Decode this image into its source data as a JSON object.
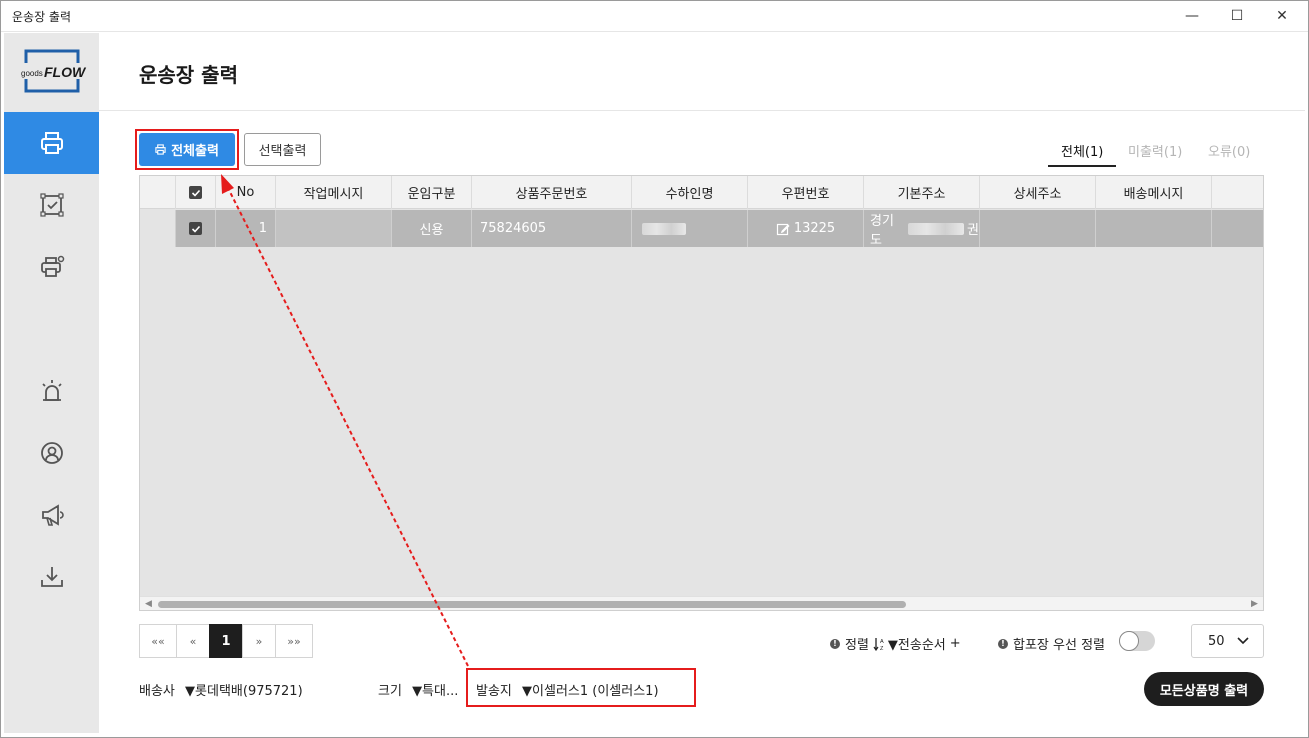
{
  "window": {
    "title": "운송장 출력",
    "minimize_glyph": "—",
    "maximize_glyph": "☐",
    "close_glyph": "✕"
  },
  "logo": {
    "text_small": "goods",
    "text_big": "FLOW"
  },
  "sidebar": {
    "items": [
      {
        "icon": "printer-icon",
        "active": true
      },
      {
        "icon": "checkbox-frame-icon",
        "active": false
      },
      {
        "icon": "printer-settings-icon",
        "active": false
      },
      {
        "icon": "alarm-icon",
        "active": false
      },
      {
        "icon": "user-circle-icon",
        "active": false
      },
      {
        "icon": "megaphone-icon",
        "active": false
      },
      {
        "icon": "download-icon",
        "active": false
      }
    ]
  },
  "page": {
    "title": "운송장 출력"
  },
  "toolbar": {
    "print_all_label": "전체출력",
    "print_selected_label": "선택출력"
  },
  "tabs": [
    {
      "label": "전체(1)",
      "active": true
    },
    {
      "label": "미출력(1)",
      "active": false
    },
    {
      "label": "오류(0)",
      "active": false
    }
  ],
  "table": {
    "columns": [
      "No",
      "작업메시지",
      "운임구분",
      "상품주문번호",
      "수하인명",
      "우편번호",
      "기본주소",
      "상세주소",
      "배송메시지"
    ],
    "rows": [
      {
        "checked": true,
        "no": "1",
        "work_message": "",
        "fare_type": "신용",
        "order_no": "75824605",
        "receiver": "",
        "zip": "13225",
        "address_prefix": "경기도",
        "address_suffix": "권",
        "detail_address": "",
        "delivery_message": ""
      }
    ]
  },
  "pagination": {
    "first": "««",
    "prev": "«",
    "current": "1",
    "next": "»",
    "last": "»»"
  },
  "sort": {
    "label": "정렬",
    "icon": "sort-az-icon",
    "value": "▼전송순서",
    "plus": "+"
  },
  "merge_sort": {
    "label": "합포장 우선 정렬",
    "enabled": false
  },
  "page_size": {
    "value": "50"
  },
  "footer": {
    "carrier_label": "배송사",
    "carrier_value": "▼롯데택배(975721)",
    "size_label": "크기",
    "size_value": "▼특대...",
    "sender_label": "발송지",
    "sender_value": "▼이셀러스1 (이셀러스1)",
    "print_all_names_label": "모든상품명 출력"
  },
  "colors": {
    "accent": "#2f8ae4",
    "highlight_red": "#e51c1c",
    "dark_button": "#1e1e1e",
    "row_selected": "#b7b7b7"
  }
}
